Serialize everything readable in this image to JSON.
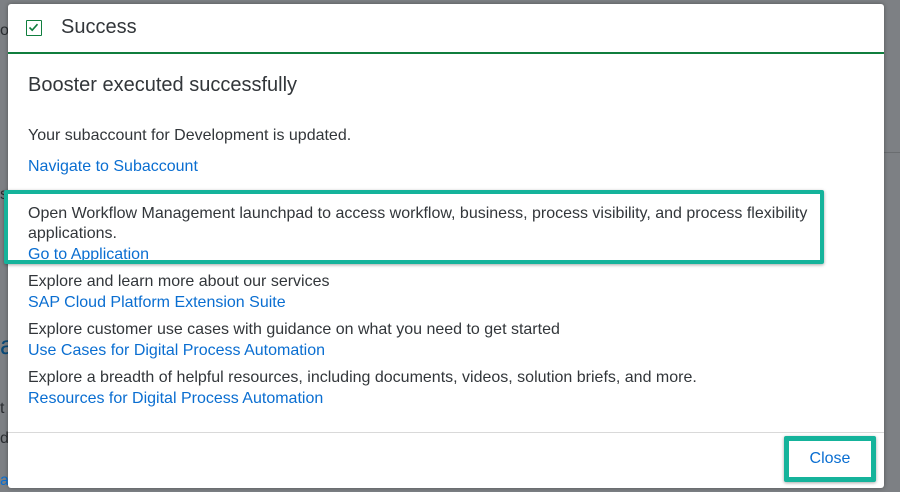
{
  "background": {
    "fragments": [
      "o",
      "s",
      "a",
      "t",
      "d",
      "art"
    ]
  },
  "dialog": {
    "title": "Success",
    "title_icon": "checkbox-checked-icon",
    "heading": "Booster executed successfully",
    "updated_text": "Your subaccount for Development is updated.",
    "navigate_link": "Navigate to Subaccount",
    "workflow_text": "Open Workflow Management launchpad to access workflow, business, process visibility, and process flexibility applications.",
    "go_to_app_link": "Go to Application",
    "explore_services_text": "Explore and learn more about our services",
    "extension_suite_link": "SAP Cloud Platform Extension Suite",
    "explore_use_cases_text": "Explore customer use cases with guidance on what you need to get started",
    "use_cases_link": "Use Cases for Digital Process Automation",
    "explore_resources_text": "Explore a breadth of helpful resources, including documents, videos, solution briefs, and more.",
    "resources_link": "Resources for Digital Process Automation",
    "close_label": "Close"
  },
  "colors": {
    "success_green": "#107e3e",
    "link_blue": "#0a6ed1",
    "highlight_teal": "#15b39b",
    "text": "#32363a"
  }
}
